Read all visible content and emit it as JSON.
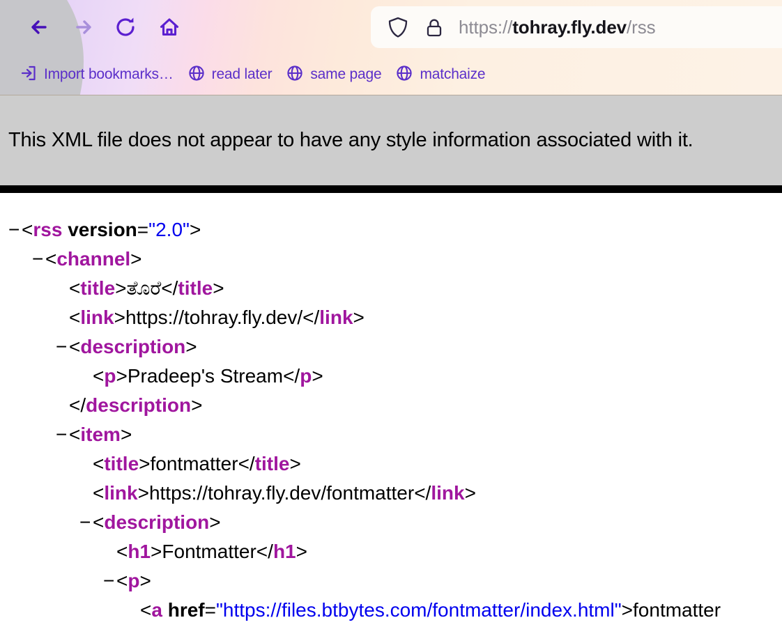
{
  "browser": {
    "nav": {
      "back_label": "Back",
      "forward_label": "Forward",
      "reload_label": "Reload",
      "home_label": "Home"
    },
    "urlbar": {
      "scheme": "https://",
      "host": "tohray.fly.dev",
      "path": "/rss",
      "full_url": "https://tohray.fly.dev/rss",
      "shield_icon": "shield-icon",
      "lock_icon": "lock-icon"
    },
    "bookmarks": [
      {
        "label": "Import bookmarks…",
        "icon": "import-icon"
      },
      {
        "label": "read later",
        "icon": "globe-icon"
      },
      {
        "label": "same page",
        "icon": "globe-icon"
      },
      {
        "label": "matchaize",
        "icon": "globe-icon"
      }
    ],
    "colors": {
      "accent_purple": "#5b2fc9",
      "url_host": "#15141a",
      "url_dim": "#8d8b93"
    }
  },
  "page": {
    "banner": "This XML file does not appear to have any style information associated with it.",
    "colors": {
      "banner_bg": "#cdcdcd",
      "rule": "#000000",
      "tag": "#a0169e",
      "attr_value": "#0000ee",
      "text": "#000000"
    },
    "xml_lines": [
      {
        "marker": "−",
        "indent": 0,
        "parts": [
          {
            "t": "punct",
            "v": "<"
          },
          {
            "t": "tag",
            "v": "rss"
          },
          {
            "t": "punct",
            "v": " "
          },
          {
            "t": "attr",
            "v": "version"
          },
          {
            "t": "punct",
            "v": "="
          },
          {
            "t": "val",
            "v": "\"2.0\""
          },
          {
            "t": "punct",
            "v": ">"
          }
        ]
      },
      {
        "marker": "−",
        "indent": 1,
        "parts": [
          {
            "t": "punct",
            "v": "<"
          },
          {
            "t": "tag",
            "v": "channel"
          },
          {
            "t": "punct",
            "v": ">"
          }
        ]
      },
      {
        "marker": "",
        "indent": 2,
        "parts": [
          {
            "t": "punct",
            "v": "<"
          },
          {
            "t": "tag",
            "v": "title"
          },
          {
            "t": "punct",
            "v": ">"
          },
          {
            "t": "txt",
            "v": "ತೊರೆ"
          },
          {
            "t": "punct",
            "v": "</"
          },
          {
            "t": "tag",
            "v": "title"
          },
          {
            "t": "punct",
            "v": ">"
          }
        ]
      },
      {
        "marker": "",
        "indent": 2,
        "parts": [
          {
            "t": "punct",
            "v": "<"
          },
          {
            "t": "tag",
            "v": "link"
          },
          {
            "t": "punct",
            "v": ">"
          },
          {
            "t": "txt",
            "v": "https://tohray.fly.dev/"
          },
          {
            "t": "punct",
            "v": "</"
          },
          {
            "t": "tag",
            "v": "link"
          },
          {
            "t": "punct",
            "v": ">"
          }
        ]
      },
      {
        "marker": "−",
        "indent": 2,
        "parts": [
          {
            "t": "punct",
            "v": "<"
          },
          {
            "t": "tag",
            "v": "description"
          },
          {
            "t": "punct",
            "v": ">"
          }
        ]
      },
      {
        "marker": "",
        "indent": 3,
        "parts": [
          {
            "t": "punct",
            "v": "<"
          },
          {
            "t": "tag",
            "v": "p"
          },
          {
            "t": "punct",
            "v": ">"
          },
          {
            "t": "txt",
            "v": "Pradeep's Stream"
          },
          {
            "t": "punct",
            "v": "</"
          },
          {
            "t": "tag",
            "v": "p"
          },
          {
            "t": "punct",
            "v": ">"
          }
        ]
      },
      {
        "marker": "",
        "indent": 2,
        "parts": [
          {
            "t": "punct",
            "v": "</"
          },
          {
            "t": "tag",
            "v": "description"
          },
          {
            "t": "punct",
            "v": ">"
          }
        ]
      },
      {
        "marker": "−",
        "indent": 2,
        "parts": [
          {
            "t": "punct",
            "v": "<"
          },
          {
            "t": "tag",
            "v": "item"
          },
          {
            "t": "punct",
            "v": ">"
          }
        ]
      },
      {
        "marker": "",
        "indent": 3,
        "parts": [
          {
            "t": "punct",
            "v": "<"
          },
          {
            "t": "tag",
            "v": "title"
          },
          {
            "t": "punct",
            "v": ">"
          },
          {
            "t": "txt",
            "v": "fontmatter"
          },
          {
            "t": "punct",
            "v": "</"
          },
          {
            "t": "tag",
            "v": "title"
          },
          {
            "t": "punct",
            "v": ">"
          }
        ]
      },
      {
        "marker": "",
        "indent": 3,
        "parts": [
          {
            "t": "punct",
            "v": "<"
          },
          {
            "t": "tag",
            "v": "link"
          },
          {
            "t": "punct",
            "v": ">"
          },
          {
            "t": "txt",
            "v": "https://tohray.fly.dev/fontmatter"
          },
          {
            "t": "punct",
            "v": "</"
          },
          {
            "t": "tag",
            "v": "link"
          },
          {
            "t": "punct",
            "v": ">"
          }
        ]
      },
      {
        "marker": "−",
        "indent": 3,
        "parts": [
          {
            "t": "punct",
            "v": "<"
          },
          {
            "t": "tag",
            "v": "description"
          },
          {
            "t": "punct",
            "v": ">"
          }
        ]
      },
      {
        "marker": "",
        "indent": 4,
        "parts": [
          {
            "t": "punct",
            "v": "<"
          },
          {
            "t": "tag",
            "v": "h1"
          },
          {
            "t": "punct",
            "v": ">"
          },
          {
            "t": "txt",
            "v": "Fontmatter"
          },
          {
            "t": "punct",
            "v": "</"
          },
          {
            "t": "tag",
            "v": "h1"
          },
          {
            "t": "punct",
            "v": ">"
          }
        ]
      },
      {
        "marker": "−",
        "indent": 4,
        "parts": [
          {
            "t": "punct",
            "v": "<"
          },
          {
            "t": "tag",
            "v": "p"
          },
          {
            "t": "punct",
            "v": ">"
          }
        ]
      },
      {
        "marker": "",
        "indent": 5,
        "parts": [
          {
            "t": "punct",
            "v": "<"
          },
          {
            "t": "tag",
            "v": "a"
          },
          {
            "t": "punct",
            "v": " "
          },
          {
            "t": "attr",
            "v": "href"
          },
          {
            "t": "punct",
            "v": "="
          },
          {
            "t": "val",
            "v": "\"https://files.btbytes.com/fontmatter/index.html\""
          },
          {
            "t": "punct",
            "v": ">"
          },
          {
            "t": "txt",
            "v": "fontmatter"
          }
        ]
      }
    ]
  }
}
